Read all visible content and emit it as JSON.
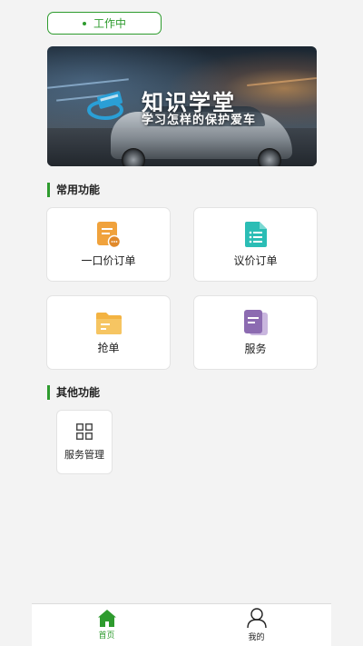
{
  "status": {
    "label": "工作中",
    "color": "#2e9b2e"
  },
  "banner": {
    "title": "知识学堂",
    "subtitle": "学习怎样的保护爱车"
  },
  "sections": {
    "common": {
      "title": "常用功能",
      "items": [
        {
          "label": "一口价订单",
          "icon": "fixed-price-order-icon",
          "color": "#f0a23c"
        },
        {
          "label": "议价订单",
          "icon": "bargain-order-icon",
          "color": "#2bbdb5"
        },
        {
          "label": "抢单",
          "icon": "grab-order-icon",
          "color": "#f3b342"
        },
        {
          "label": "服务",
          "icon": "service-icon",
          "color": "#8c6bb1"
        }
      ]
    },
    "other": {
      "title": "其他功能",
      "items": [
        {
          "label": "服务管理",
          "icon": "grid-icon"
        }
      ]
    }
  },
  "tabbar": {
    "items": [
      {
        "label": "首页",
        "icon": "home-icon",
        "active": true
      },
      {
        "label": "我的",
        "icon": "user-icon",
        "active": false
      }
    ],
    "active_color": "#2e9b2e"
  }
}
